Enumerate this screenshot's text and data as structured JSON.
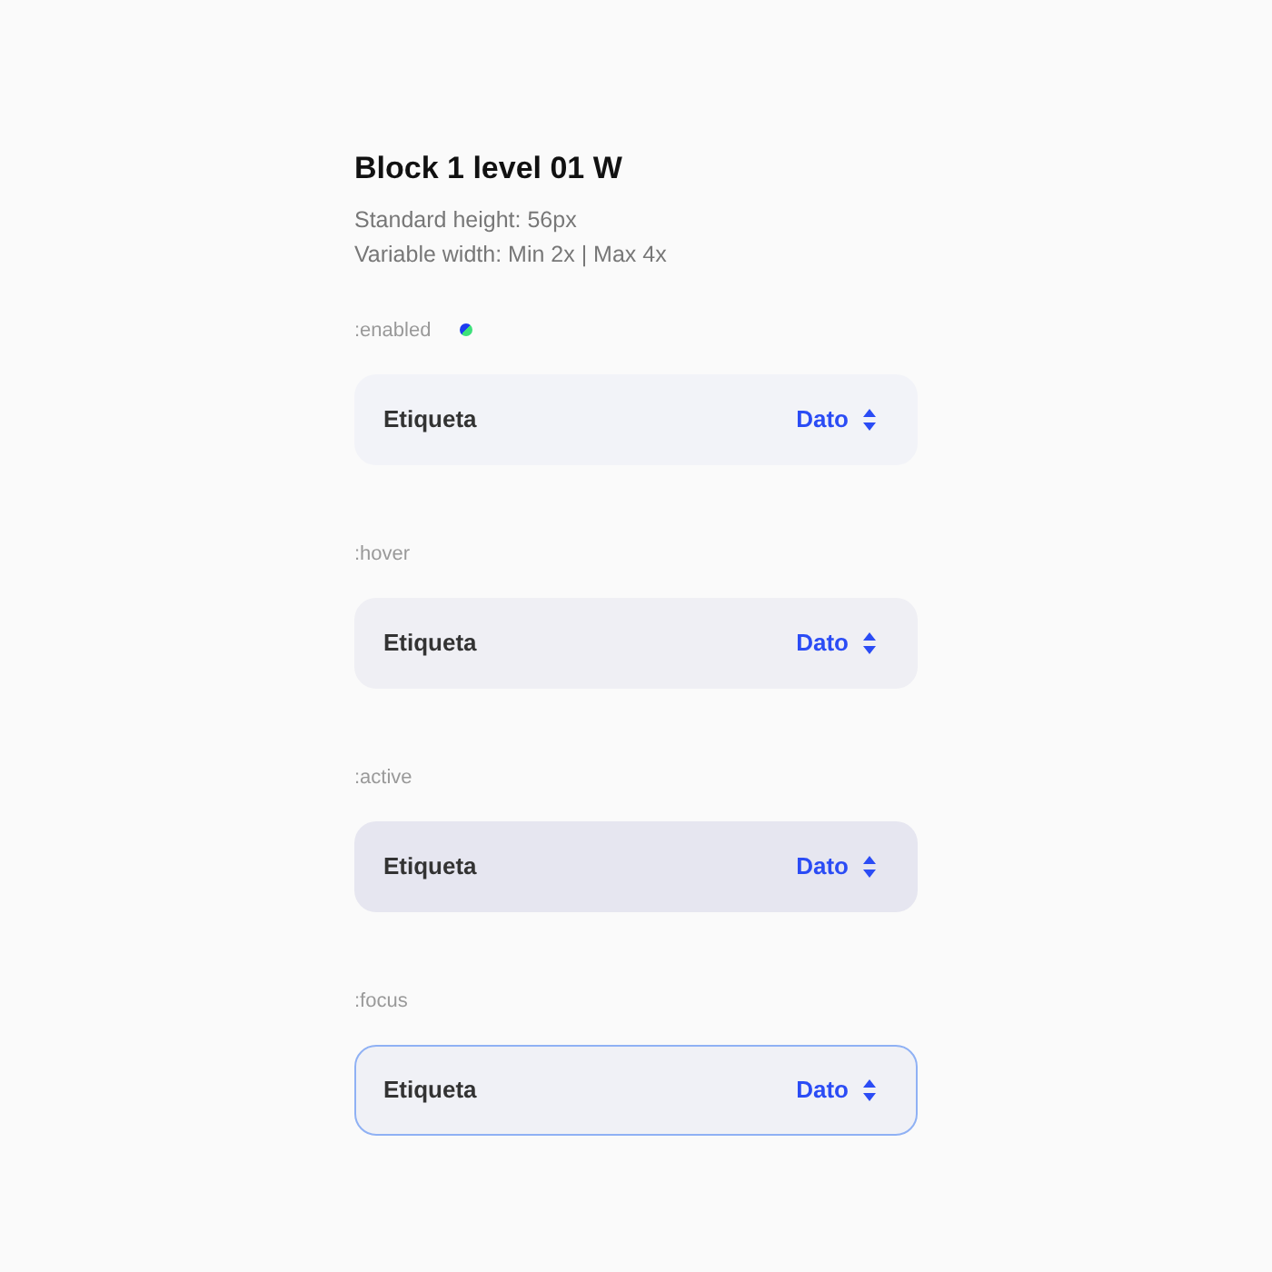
{
  "title": "Block 1 level 01 W",
  "subtitle_lines": [
    "Standard height: 56px",
    "Variable width: Min 2x | Max 4x"
  ],
  "variants": [
    {
      "state_label": ":enabled",
      "kind": "enabled",
      "marker": true,
      "label": "Etiqueta",
      "value": "Dato"
    },
    {
      "state_label": ":hover",
      "kind": "hover",
      "marker": false,
      "label": "Etiqueta",
      "value": "Dato"
    },
    {
      "state_label": ":active",
      "kind": "active",
      "marker": false,
      "label": "Etiqueta",
      "value": "Dato"
    },
    {
      "state_label": ":focus",
      "kind": "focus",
      "marker": false,
      "label": "Etiqueta",
      "value": "Dato"
    }
  ]
}
